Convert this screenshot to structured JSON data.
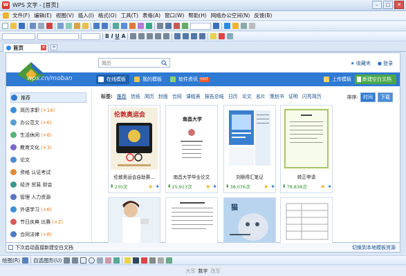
{
  "window": {
    "title": "WPS 文字 - [首页]"
  },
  "menu": [
    "文件(F)",
    "编辑(E)",
    "视图(V)",
    "插入(I)",
    "格式(O)",
    "工具(T)",
    "表格(A)",
    "窗口(W)",
    "帮助(H)",
    "网络办公空间(N)",
    "反馈(B)"
  ],
  "tabs": {
    "home": "首页"
  },
  "search": {
    "placeholder": "简历"
  },
  "header_links": {
    "favorites": "收藏夹",
    "login": "登录"
  },
  "site_text": "wps.cn/moban",
  "bluebar_tabs": [
    {
      "label": "在线模板",
      "active": true
    },
    {
      "label": "我的模板",
      "active": false
    },
    {
      "label": "软件资讯",
      "active": false,
      "badge": "HOT"
    }
  ],
  "upload_label": "上传模板",
  "new_doc_label": "新建空白文档",
  "sidebar": [
    {
      "label": "推荐",
      "count": ""
    },
    {
      "label": "简历求职",
      "count": "(+14)"
    },
    {
      "label": "办公范文",
      "count": "(+6)"
    },
    {
      "label": "生活休闲",
      "count": "(+6)"
    },
    {
      "label": "教育文化",
      "count": "(+3)"
    },
    {
      "label": "论文",
      "count": ""
    },
    {
      "label": "资格 认证考试",
      "count": ""
    },
    {
      "label": "经济 贸易 财会",
      "count": ""
    },
    {
      "label": "管理 人力资源",
      "count": ""
    },
    {
      "label": "外语学习",
      "count": "(+6)"
    },
    {
      "label": "节日庆典 比赛",
      "count": "(+2)"
    },
    {
      "label": "合同法律",
      "count": "(+8)"
    }
  ],
  "tags": {
    "label": "标签:",
    "items": [
      "推荐",
      "信纸",
      "简历",
      "封面",
      "合同",
      "课程表",
      "报告总结",
      "日历",
      "论文",
      "名片",
      "策划书",
      "证明",
      "闪亮简历"
    ]
  },
  "sort": {
    "label": "排序:",
    "by_time": "时间",
    "by_downloads": "下载"
  },
  "cards": [
    {
      "name": "伦敦奥运会自助赛...",
      "downloads": "230次",
      "cover_title": "伦敦奥运会"
    },
    {
      "name": "南昌大学毕业论文",
      "downloads": "25,913次",
      "cover_title": "南昌大学"
    },
    {
      "name": "刘晰得汇笔记",
      "downloads": "38,076次",
      "cover_title": ""
    },
    {
      "name": "转正申请",
      "downloads": "78,838次",
      "cover_title": ""
    }
  ],
  "cards_row2": [
    {
      "cover_title": ""
    },
    {
      "cover_title": ""
    },
    {
      "cover_title": "猫"
    },
    {
      "cover_title": ""
    }
  ],
  "bottom": {
    "startup_label": "下次启动直接新建空白文档",
    "switch_link": "切换到本地模板资源"
  },
  "drawbar": {
    "draw_label": "绘图(R)",
    "autoshape_label": "自选图形(U)"
  },
  "status": {
    "caps": "大写",
    "num": "数字",
    "overtype": "改写"
  },
  "colors": {
    "accent": "#2f7ad2",
    "new_doc": "#4aa84a",
    "count": "#e37a17",
    "downloads": "#2d8b2d"
  }
}
